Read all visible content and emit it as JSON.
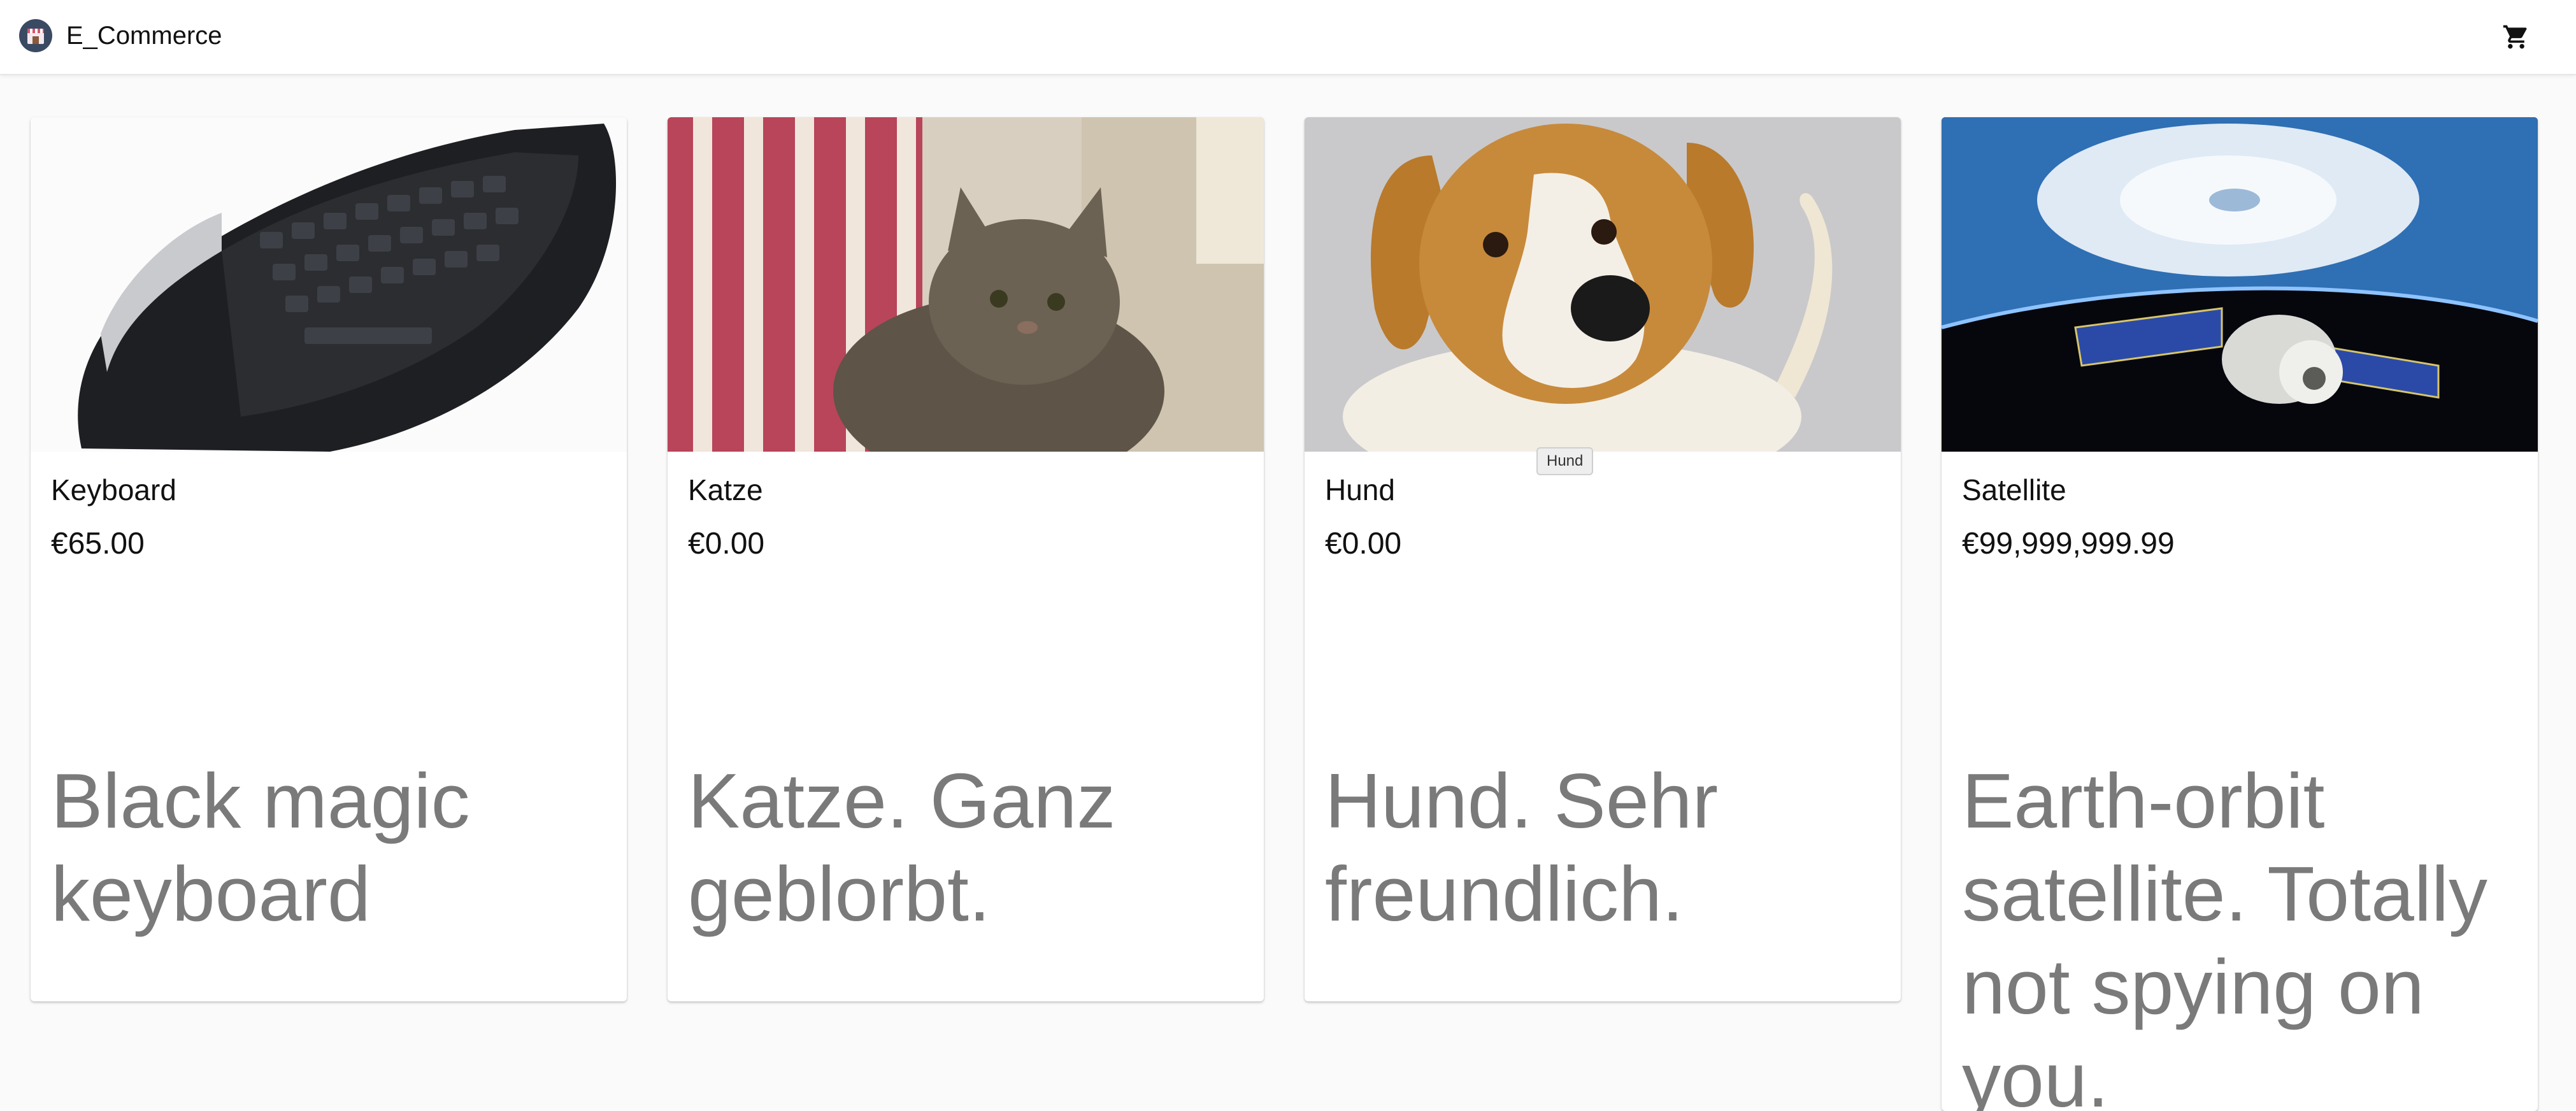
{
  "app": {
    "title": "E_Commerce",
    "logo_icon": "shop-logo-icon",
    "cart_icon": "shopping-cart-icon"
  },
  "products": [
    {
      "name": "Keyboard",
      "price": "€65.00",
      "description": "Black magic keyboard",
      "image": "keyboard-photo",
      "add_icon": "add-shopping-cart-icon"
    },
    {
      "name": "Katze",
      "price": "€0.00",
      "description": "Katze. Ganz geblorbt.",
      "image": "cat-photo",
      "add_icon": "add-shopping-cart-icon"
    },
    {
      "name": "Hund",
      "price": "€0.00",
      "description": "Hund. Sehr freundlich.",
      "image": "dog-photo",
      "add_icon": "add-shopping-cart-icon"
    },
    {
      "name": "Satellite",
      "price": "€99,999,999.99",
      "description": "Earth-orbit satellite. Totally not spying on you.",
      "image": "satellite-photo"
    }
  ],
  "tooltip": {
    "text": "Hund"
  },
  "colors": {
    "background": "#fafafa",
    "card": "#ffffff",
    "description_text": "#7a7a7a"
  }
}
